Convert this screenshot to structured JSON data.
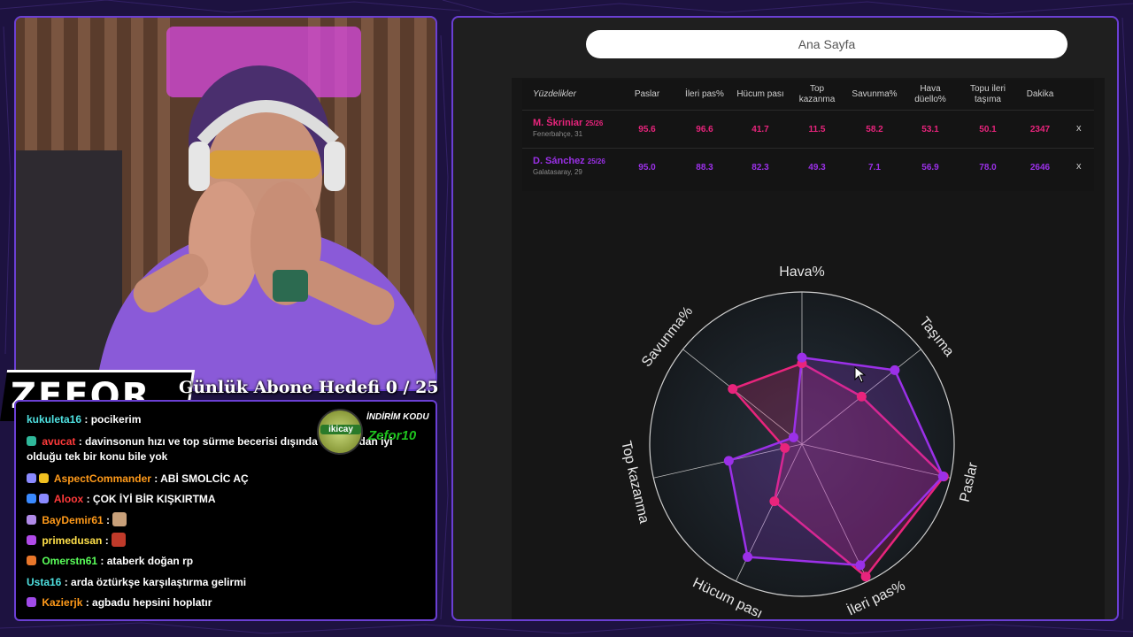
{
  "colors": {
    "accent_purple": "#6b3fd4",
    "player1_color": "#e8247c",
    "player2_color": "#9b30e8",
    "chat_text": "#ffffff"
  },
  "overlay": {
    "brand": "ZEFOR",
    "goal": "Günlük Abone Hedefi 0 / 25"
  },
  "promo": {
    "logo_text": "ikicay",
    "label": "İNDİRİM KODU",
    "code": "Zefor10"
  },
  "chat": {
    "messages": [
      {
        "user": "kukuleta16",
        "user_color": "#4fe0e0",
        "text": "pocikerim",
        "badges": []
      },
      {
        "user": "avucat",
        "user_color": "#ff3a3a",
        "text": "davinsonun hızı ve top sürme becerisi dışında skriniardan iyi olduğu tek bir konu bile yok",
        "badges": [
          "shield-icon"
        ]
      },
      {
        "user": "AspectCommander",
        "user_color": "#ff9a1a",
        "text": "ABİ SMOLCİC AÇ",
        "badges": [
          "shield-icon",
          "crown-icon"
        ]
      },
      {
        "user": "Aloox",
        "user_color": "#ff3a3a",
        "text": "ÇOK İYİ BİR KIŞKIRTMA",
        "badges": [
          "arrow-badge-icon",
          "shield-icon"
        ]
      },
      {
        "user": "BayDemir61",
        "user_color": "#ff9a1a",
        "text": "",
        "badges": [
          "shield-icon"
        ],
        "emote": "emote-face-icon"
      },
      {
        "user": "primedusan",
        "user_color": "#ffe04a",
        "text": "",
        "badges": [
          "shield-icon"
        ],
        "emote": "emote-red-icon"
      },
      {
        "user": "Omerstn61",
        "user_color": "#5aff5a",
        "text": "ataberk doğan rp",
        "badges": [
          "shield-icon"
        ]
      },
      {
        "user": "Usta16",
        "user_color": "#4fe0e0",
        "text": "arda öztürkşe karşılaştırma gelirmi",
        "badges": []
      },
      {
        "user": "Kazierjk",
        "user_color": "#ff9a1a",
        "text": "agbadu hepsini hoplatır",
        "badges": [
          "shield-icon"
        ]
      }
    ]
  },
  "browser": {
    "address_text": "Ana Sayfa"
  },
  "table": {
    "headers": [
      "Yüzdelikler",
      "Paslar",
      "İleri pas%",
      "Hücum pası",
      "Top kazanma",
      "Savunma%",
      "Hava düello%",
      "Topu ileri taşıma",
      "Dakika"
    ],
    "rows": [
      {
        "name": "M. Škriniar",
        "season": "25/26",
        "team": "Fenerbahçe, 31",
        "color": "#e8247c",
        "values": [
          "95.6",
          "96.6",
          "41.7",
          "11.5",
          "58.2",
          "53.1",
          "50.1",
          "2347"
        ],
        "remove": "x"
      },
      {
        "name": "D. Sánchez",
        "season": "25/26",
        "team": "Galatasaray, 29",
        "color": "#9b30e8",
        "values": [
          "95.0",
          "88.3",
          "82.3",
          "49.3",
          "7.1",
          "56.9",
          "78.0",
          "2646"
        ],
        "remove": "x"
      }
    ]
  },
  "chart_data": {
    "type": "radar",
    "axes": [
      "Hava%",
      "Taşıma",
      "Paslar",
      "İleri pas%",
      "Hücum pası",
      "Top kazanma",
      "Savunma%"
    ],
    "range": [
      0,
      100
    ],
    "series": [
      {
        "name": "M. Škriniar",
        "values": [
          53.1,
          50.1,
          95.6,
          96.6,
          41.7,
          11.5,
          58.2
        ]
      },
      {
        "name": "D. Sánchez",
        "values": [
          56.9,
          78.0,
          95.0,
          88.3,
          82.3,
          49.3,
          7.1
        ]
      }
    ]
  }
}
